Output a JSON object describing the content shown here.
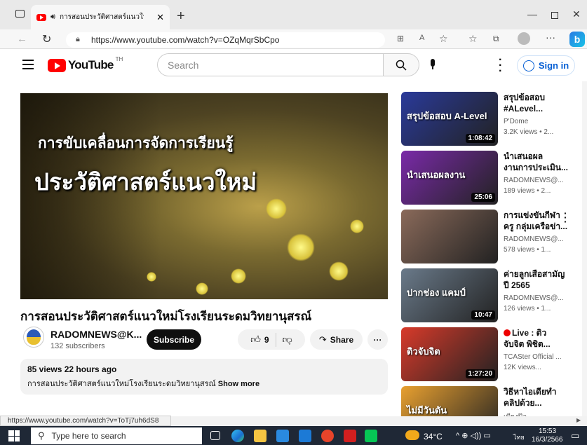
{
  "browser": {
    "tab_title": "การสอนประวัติศาสตร์แนวใหม่โรง",
    "url": "https://www.youtube.com/watch?v=OZqMqrSbCpo",
    "status_url": "https://www.youtube.com/watch?v=ToTj7uh6dS8"
  },
  "youtube": {
    "logo_text": "YouTube",
    "region": "TH",
    "search_placeholder": "Search",
    "sign_in": "Sign in"
  },
  "video": {
    "overlay_line1": "การขับเคลื่อนการจัดการเรียนรู้",
    "overlay_line2": "ประวัติศาสตร์แนวใหม่",
    "title": "การสอนประวัติศาสตร์แนวใหม่โรงเรียนระดมวิทยานุสรณ์",
    "channel": "RADOMNEWS@K...",
    "subscribers": "132 subscribers",
    "subscribe": "Subscribe",
    "likes": "9",
    "share": "Share",
    "stats": "85 views  22 hours ago",
    "description": "การสอนประวัติศาสตร์แนวใหม่โรงเรียนระดมวิทยานุสรณ์",
    "show_more": "Show more"
  },
  "related": [
    {
      "title": "สรุปข้อสอบ\n#ALevel...",
      "channel": "P'Dome",
      "meta": "3.2K views • 2...",
      "duration": "1:08:42",
      "thumb_text": "สรุปข้อสอบ A-Level",
      "bg": "#2a3a9a"
    },
    {
      "title": "นำเสนอผล\nงานการประเมิน...",
      "channel": "RADOMNEWS@...",
      "meta": "189 views • 2...",
      "duration": "25:06",
      "thumb_text": "นำเสนอผลงาน",
      "bg": "#7a2aa8"
    },
    {
      "title": "การแข่งขันกีฬา\nครู กลุ่มเครือข่า...",
      "channel": "RADOMNEWS@...",
      "meta": "578 views • 1...",
      "duration": "",
      "thumb_text": "",
      "bg": "#8a6a5a"
    },
    {
      "title": "ค่ายลูกเสือสามัญ\nปี 2565",
      "channel": "RADOMNEWS@...",
      "meta": "126 views • 1...",
      "duration": "10:47",
      "thumb_text": "ปากช่อง แคมป์",
      "bg": "#6a7a8a"
    },
    {
      "title": "Live : ติว\nจับจิต พิชิต...",
      "channel": "TCASter Official ...",
      "meta": "12K views...",
      "duration": "1:27:20",
      "thumb_text": "ติวจับจิต",
      "bg": "#d83a2a"
    },
    {
      "title": "วิธีหาไอเดียทำ\nคลิปด้วย...",
      "channel": "เพียงป๊อ",
      "meta": "",
      "duration": "",
      "thumb_text": "ไม่มีวันตัน",
      "bg": "#e8a030"
    }
  ],
  "taskbar": {
    "search_placeholder": "Type here to search",
    "weather": "34°C",
    "lang": "ไทย",
    "time": "15:53",
    "date": "16/3/2566"
  }
}
